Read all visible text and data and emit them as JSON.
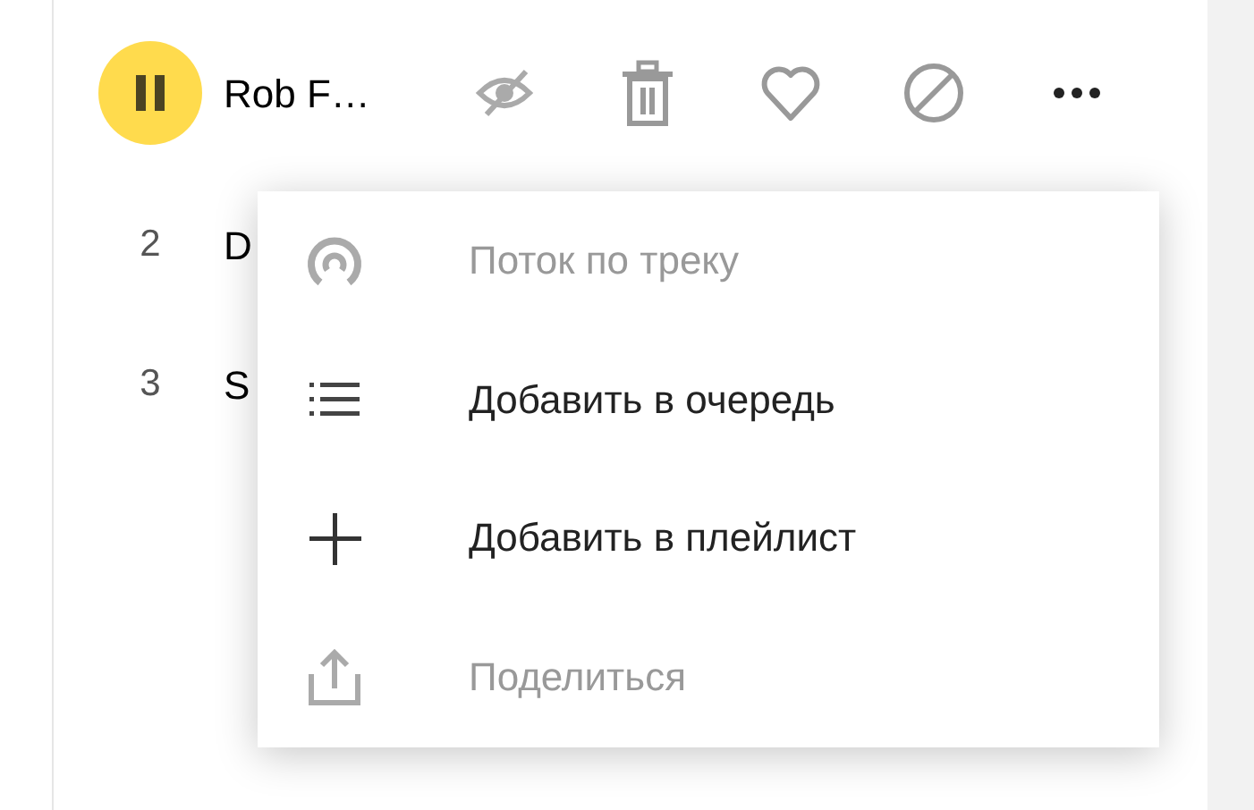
{
  "tracks": [
    {
      "title": "Rob F…",
      "playing": true
    },
    {
      "number": "2",
      "title": "D",
      "playing": false
    },
    {
      "number": "3",
      "title": "S",
      "playing": false
    }
  ],
  "context_menu": {
    "items": [
      {
        "kind": "stream",
        "label": "Поток по треку",
        "disabled": true
      },
      {
        "kind": "queue",
        "label": "Добавить в очередь",
        "disabled": false
      },
      {
        "kind": "playlist",
        "label": "Добавить в плейлист",
        "disabled": false
      },
      {
        "kind": "share",
        "label": "Поделиться",
        "disabled": true
      }
    ]
  }
}
